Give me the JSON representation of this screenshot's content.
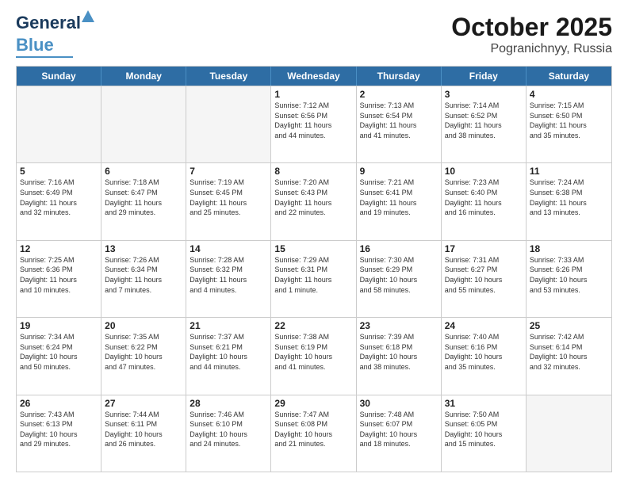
{
  "logo": {
    "line1": "General",
    "line2": "Blue"
  },
  "header": {
    "month": "October 2025",
    "location": "Pogranichnyy, Russia"
  },
  "weekdays": [
    "Sunday",
    "Monday",
    "Tuesday",
    "Wednesday",
    "Thursday",
    "Friday",
    "Saturday"
  ],
  "rows": [
    [
      {
        "day": "",
        "info": "",
        "empty": true
      },
      {
        "day": "",
        "info": "",
        "empty": true
      },
      {
        "day": "",
        "info": "",
        "empty": true
      },
      {
        "day": "1",
        "info": "Sunrise: 7:12 AM\nSunset: 6:56 PM\nDaylight: 11 hours\nand 44 minutes."
      },
      {
        "day": "2",
        "info": "Sunrise: 7:13 AM\nSunset: 6:54 PM\nDaylight: 11 hours\nand 41 minutes."
      },
      {
        "day": "3",
        "info": "Sunrise: 7:14 AM\nSunset: 6:52 PM\nDaylight: 11 hours\nand 38 minutes."
      },
      {
        "day": "4",
        "info": "Sunrise: 7:15 AM\nSunset: 6:50 PM\nDaylight: 11 hours\nand 35 minutes."
      }
    ],
    [
      {
        "day": "5",
        "info": "Sunrise: 7:16 AM\nSunset: 6:49 PM\nDaylight: 11 hours\nand 32 minutes."
      },
      {
        "day": "6",
        "info": "Sunrise: 7:18 AM\nSunset: 6:47 PM\nDaylight: 11 hours\nand 29 minutes."
      },
      {
        "day": "7",
        "info": "Sunrise: 7:19 AM\nSunset: 6:45 PM\nDaylight: 11 hours\nand 25 minutes."
      },
      {
        "day": "8",
        "info": "Sunrise: 7:20 AM\nSunset: 6:43 PM\nDaylight: 11 hours\nand 22 minutes."
      },
      {
        "day": "9",
        "info": "Sunrise: 7:21 AM\nSunset: 6:41 PM\nDaylight: 11 hours\nand 19 minutes."
      },
      {
        "day": "10",
        "info": "Sunrise: 7:23 AM\nSunset: 6:40 PM\nDaylight: 11 hours\nand 16 minutes."
      },
      {
        "day": "11",
        "info": "Sunrise: 7:24 AM\nSunset: 6:38 PM\nDaylight: 11 hours\nand 13 minutes."
      }
    ],
    [
      {
        "day": "12",
        "info": "Sunrise: 7:25 AM\nSunset: 6:36 PM\nDaylight: 11 hours\nand 10 minutes."
      },
      {
        "day": "13",
        "info": "Sunrise: 7:26 AM\nSunset: 6:34 PM\nDaylight: 11 hours\nand 7 minutes."
      },
      {
        "day": "14",
        "info": "Sunrise: 7:28 AM\nSunset: 6:32 PM\nDaylight: 11 hours\nand 4 minutes."
      },
      {
        "day": "15",
        "info": "Sunrise: 7:29 AM\nSunset: 6:31 PM\nDaylight: 11 hours\nand 1 minute."
      },
      {
        "day": "16",
        "info": "Sunrise: 7:30 AM\nSunset: 6:29 PM\nDaylight: 10 hours\nand 58 minutes."
      },
      {
        "day": "17",
        "info": "Sunrise: 7:31 AM\nSunset: 6:27 PM\nDaylight: 10 hours\nand 55 minutes."
      },
      {
        "day": "18",
        "info": "Sunrise: 7:33 AM\nSunset: 6:26 PM\nDaylight: 10 hours\nand 53 minutes."
      }
    ],
    [
      {
        "day": "19",
        "info": "Sunrise: 7:34 AM\nSunset: 6:24 PM\nDaylight: 10 hours\nand 50 minutes."
      },
      {
        "day": "20",
        "info": "Sunrise: 7:35 AM\nSunset: 6:22 PM\nDaylight: 10 hours\nand 47 minutes."
      },
      {
        "day": "21",
        "info": "Sunrise: 7:37 AM\nSunset: 6:21 PM\nDaylight: 10 hours\nand 44 minutes."
      },
      {
        "day": "22",
        "info": "Sunrise: 7:38 AM\nSunset: 6:19 PM\nDaylight: 10 hours\nand 41 minutes."
      },
      {
        "day": "23",
        "info": "Sunrise: 7:39 AM\nSunset: 6:18 PM\nDaylight: 10 hours\nand 38 minutes."
      },
      {
        "day": "24",
        "info": "Sunrise: 7:40 AM\nSunset: 6:16 PM\nDaylight: 10 hours\nand 35 minutes."
      },
      {
        "day": "25",
        "info": "Sunrise: 7:42 AM\nSunset: 6:14 PM\nDaylight: 10 hours\nand 32 minutes."
      }
    ],
    [
      {
        "day": "26",
        "info": "Sunrise: 7:43 AM\nSunset: 6:13 PM\nDaylight: 10 hours\nand 29 minutes."
      },
      {
        "day": "27",
        "info": "Sunrise: 7:44 AM\nSunset: 6:11 PM\nDaylight: 10 hours\nand 26 minutes."
      },
      {
        "day": "28",
        "info": "Sunrise: 7:46 AM\nSunset: 6:10 PM\nDaylight: 10 hours\nand 24 minutes."
      },
      {
        "day": "29",
        "info": "Sunrise: 7:47 AM\nSunset: 6:08 PM\nDaylight: 10 hours\nand 21 minutes."
      },
      {
        "day": "30",
        "info": "Sunrise: 7:48 AM\nSunset: 6:07 PM\nDaylight: 10 hours\nand 18 minutes."
      },
      {
        "day": "31",
        "info": "Sunrise: 7:50 AM\nSunset: 6:05 PM\nDaylight: 10 hours\nand 15 minutes."
      },
      {
        "day": "",
        "info": "",
        "empty": true
      }
    ]
  ]
}
